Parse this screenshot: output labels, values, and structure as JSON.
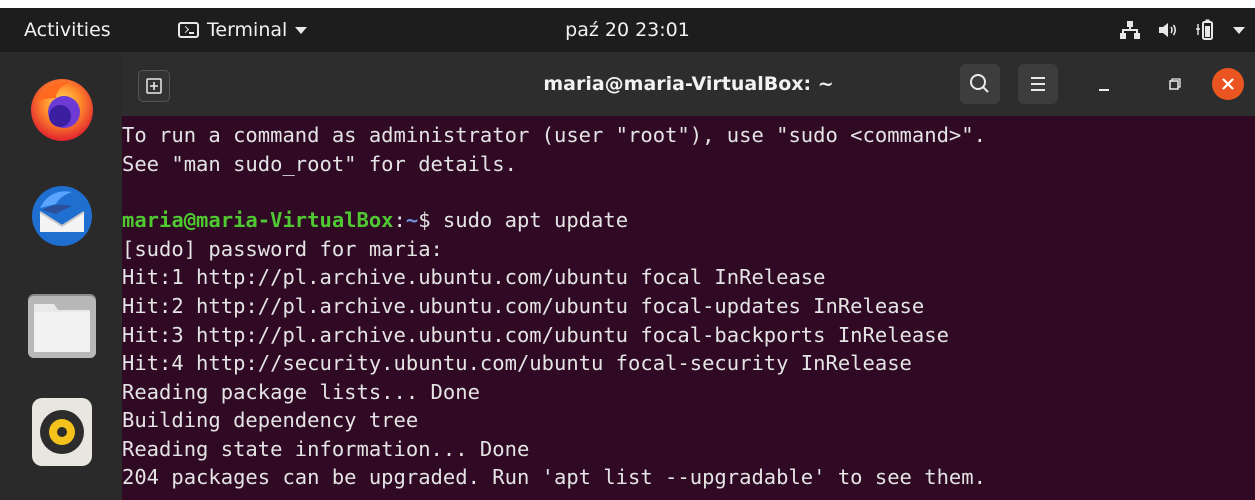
{
  "topbar": {
    "activities_label": "Activities",
    "app_menu_label": "Terminal",
    "clock": "paź 20  23:01"
  },
  "dock": {
    "apps": [
      "firefox-icon",
      "thunderbird-icon",
      "files-icon",
      "rhythmbox-icon"
    ]
  },
  "window": {
    "title": "maria@maria-VirtualBox: ~",
    "accent_color": "#e95420",
    "terminal_bg": "#300a24"
  },
  "terminal": {
    "lines": {
      "l1": "To run a command as administrator (user \"root\"), use \"sudo <command>\".",
      "l2": "See \"man sudo_root\" for details.",
      "prompt_user": "maria@maria-VirtualBox",
      "prompt_colon": ":",
      "prompt_path": "~",
      "prompt_dollar": "$ ",
      "command": "sudo apt update",
      "l4": "[sudo] password for maria:",
      "l5": "Hit:1 http://pl.archive.ubuntu.com/ubuntu focal InRelease",
      "l6": "Hit:2 http://pl.archive.ubuntu.com/ubuntu focal-updates InRelease",
      "l7": "Hit:3 http://pl.archive.ubuntu.com/ubuntu focal-backports InRelease",
      "l8": "Hit:4 http://security.ubuntu.com/ubuntu focal-security InRelease",
      "l9": "Reading package lists... Done",
      "l10": "Building dependency tree",
      "l11": "Reading state information... Done",
      "l12": "204 packages can be upgraded. Run 'apt list --upgradable' to see them."
    }
  }
}
